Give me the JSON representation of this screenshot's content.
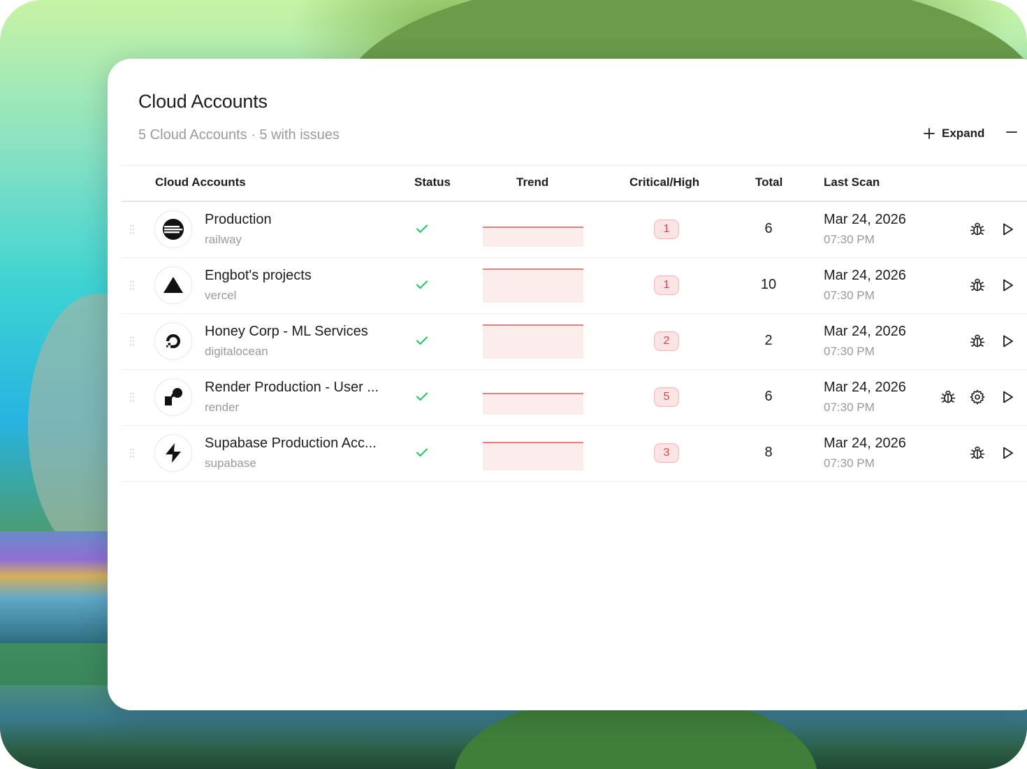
{
  "card": {
    "title": "Cloud Accounts",
    "subtitle": "5 Cloud Accounts · 5 with issues",
    "expand_label": "Expand"
  },
  "table": {
    "columns": [
      "Cloud Accounts",
      "Status",
      "Trend",
      "Critical/High",
      "Total",
      "Last Scan"
    ],
    "rows": [
      {
        "name": "Production",
        "provider": "railway",
        "status": "ok",
        "critical_high": "1",
        "total": "6",
        "date": "Mar 24, 2026",
        "time": "07:30 PM",
        "logo_icon": "railway-logo-icon",
        "actions": [
          "bug-icon",
          "play-icon"
        ]
      },
      {
        "name": "Engbot's projects",
        "provider": "vercel",
        "status": "ok",
        "critical_high": "1",
        "total": "10",
        "date": "Mar 24, 2026",
        "time": "07:30 PM",
        "logo_icon": "vercel-logo-icon",
        "actions": [
          "bug-icon",
          "play-icon"
        ]
      },
      {
        "name": "Honey Corp - ML Services",
        "provider": "digitalocean",
        "status": "ok",
        "critical_high": "2",
        "total": "2",
        "date": "Mar 24, 2026",
        "time": "07:30 PM",
        "logo_icon": "digitalocean-logo-icon",
        "actions": [
          "bug-icon",
          "play-icon"
        ]
      },
      {
        "name": "Render Production - User ...",
        "provider": "render",
        "status": "ok",
        "critical_high": "5",
        "total": "6",
        "date": "Mar 24, 2026",
        "time": "07:30 PM",
        "logo_icon": "render-logo-icon",
        "actions": [
          "bug-icon",
          "gear-icon",
          "play-icon"
        ]
      },
      {
        "name": "Supabase Production Acc...",
        "provider": "supabase",
        "status": "ok",
        "critical_high": "3",
        "total": "8",
        "date": "Mar 24, 2026",
        "time": "07:30 PM",
        "logo_icon": "supabase-logo-icon",
        "actions": [
          "bug-icon",
          "play-icon"
        ]
      }
    ]
  },
  "colors": {
    "accent_green": "#22c55e",
    "trend_line": "#e25555",
    "trend_fill": "#fdecec",
    "badge_bg": "#fde4e4",
    "badge_text": "#e04545"
  }
}
